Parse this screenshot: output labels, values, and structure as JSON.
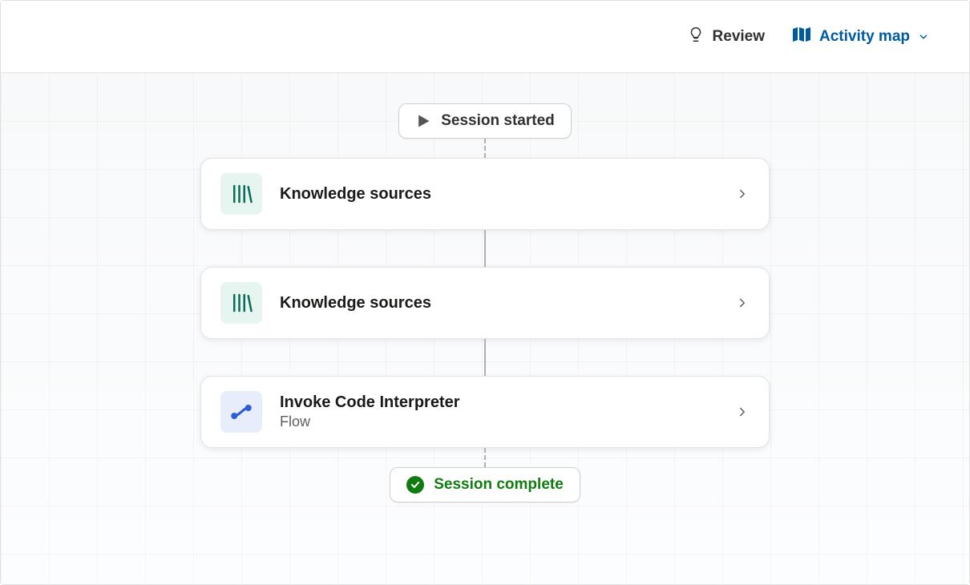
{
  "toolbar": {
    "review_label": "Review",
    "activity_map_label": "Activity map"
  },
  "session": {
    "started_label": "Session started",
    "complete_label": "Session complete"
  },
  "nodes": [
    {
      "title": "Knowledge sources",
      "subtitle": null,
      "icon": "books",
      "iconBg": "mint"
    },
    {
      "title": "Knowledge sources",
      "subtitle": null,
      "icon": "books",
      "iconBg": "mint"
    },
    {
      "title": "Invoke Code Interpreter",
      "subtitle": "Flow",
      "icon": "flow",
      "iconBg": "blue"
    }
  ]
}
